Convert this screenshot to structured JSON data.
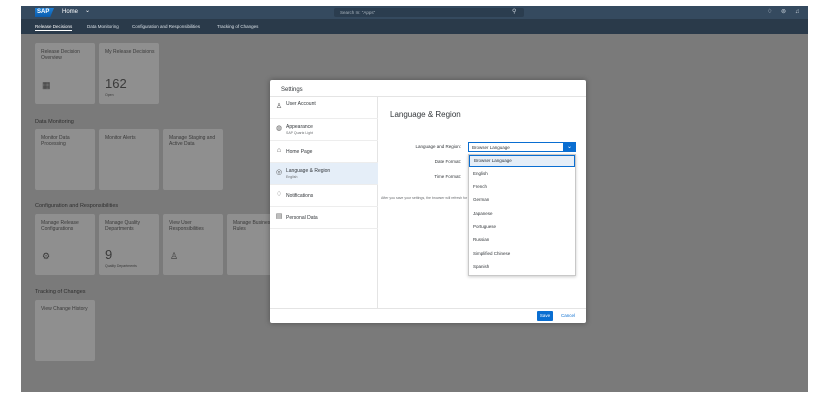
{
  "shell": {
    "logo": "SAP",
    "home_label": "Home",
    "search_placeholder": "Search In: \"Apps\""
  },
  "nav": {
    "tabs": [
      {
        "label": "Release Decisions"
      },
      {
        "label": "Data Monitoring"
      },
      {
        "label": "Configuration and Responsibilities"
      },
      {
        "label": "Tracking of Changes"
      }
    ]
  },
  "groups": {
    "release": {
      "tiles": [
        {
          "title": "Release Decision Overview"
        },
        {
          "title": "My Release Decisions",
          "number": "162",
          "sub": "Open"
        }
      ]
    },
    "monitoring": {
      "title": "Data Monitoring",
      "tiles": [
        {
          "title": "Monitor Data Processing"
        },
        {
          "title": "Monitor Alerts"
        },
        {
          "title": "Manage Staging and Active Data"
        }
      ]
    },
    "config": {
      "title": "Configuration and Responsibilities",
      "tiles": [
        {
          "title": "Manage Release Configurations"
        },
        {
          "title": "Manage Quality Departments",
          "number": "9",
          "sub": "Quality Departments"
        },
        {
          "title": "View User Responsibilities"
        },
        {
          "title": "Manage Business Rules"
        }
      ]
    },
    "tracking": {
      "title": "Tracking of Changes",
      "tiles": [
        {
          "title": "View Change History"
        }
      ]
    }
  },
  "dialog": {
    "title": "Settings",
    "sidebar": [
      {
        "label": "User Account",
        "sub": ""
      },
      {
        "label": "Appearance",
        "sub": "SAP Quartz Light"
      },
      {
        "label": "Home Page",
        "sub": ""
      },
      {
        "label": "Language & Region",
        "sub": "English"
      },
      {
        "label": "Notifications",
        "sub": ""
      },
      {
        "label": "Personal Data",
        "sub": ""
      }
    ],
    "main_title": "Language & Region",
    "fields": {
      "language_label": "Language and Region:",
      "language_value": "Browser Language",
      "date_label": "Date Format:",
      "time_label": "Time Format:"
    },
    "note": "After you save your settings, the browser will refresh for the new settings to take effect.",
    "options": [
      "Browser Language",
      "English",
      "French",
      "German",
      "Japanese",
      "Portuguese",
      "Russian",
      "Simplified Chinese",
      "Spanish"
    ],
    "save_label": "Save",
    "cancel_label": "Cancel"
  },
  "colors": {
    "shell": "#354a5f",
    "nav": "#2a3a4a",
    "accent": "#0a6ed1",
    "overlay": "#7a7a7a"
  }
}
